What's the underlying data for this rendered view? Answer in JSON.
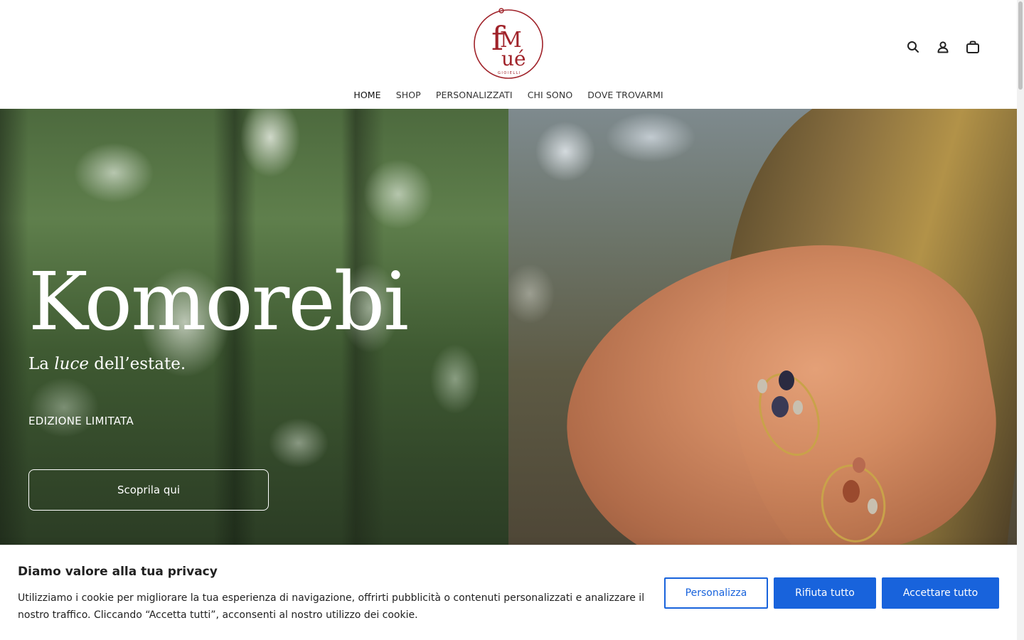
{
  "brand": {
    "logo_letters": "fMué",
    "logo_subtext": "GIOIELLI",
    "logo_color": "#a0232a"
  },
  "header": {
    "icons": [
      "search-icon",
      "user-icon",
      "bag-icon"
    ]
  },
  "nav": {
    "items": [
      {
        "label": "HOME"
      },
      {
        "label": "SHOP"
      },
      {
        "label": "PERSONALIZZATI"
      },
      {
        "label": "CHI SONO"
      },
      {
        "label": "DOVE TROVARMI"
      }
    ]
  },
  "hero": {
    "title": "Komorebi",
    "tagline_before": "La ",
    "tagline_emphasis": "luce",
    "tagline_after": " dell’estate.",
    "label": "EDIZIONE LIMITATA",
    "cta": "Scoprila qui"
  },
  "cookie": {
    "title": "Diamo valore alla tua privacy",
    "text": "Utilizziamo i cookie per migliorare la tua esperienza di navigazione, offrirti pubblicità o contenuti personalizzati e analizzare il nostro traffico. Cliccando “Accetta tutti”, acconsenti al nostro utilizzo dei cookie.",
    "customize_label": "Personalizza",
    "reject_label": "Rifiuta tutto",
    "accept_label": "Accettare tutto",
    "accent_color": "#1863dc"
  }
}
